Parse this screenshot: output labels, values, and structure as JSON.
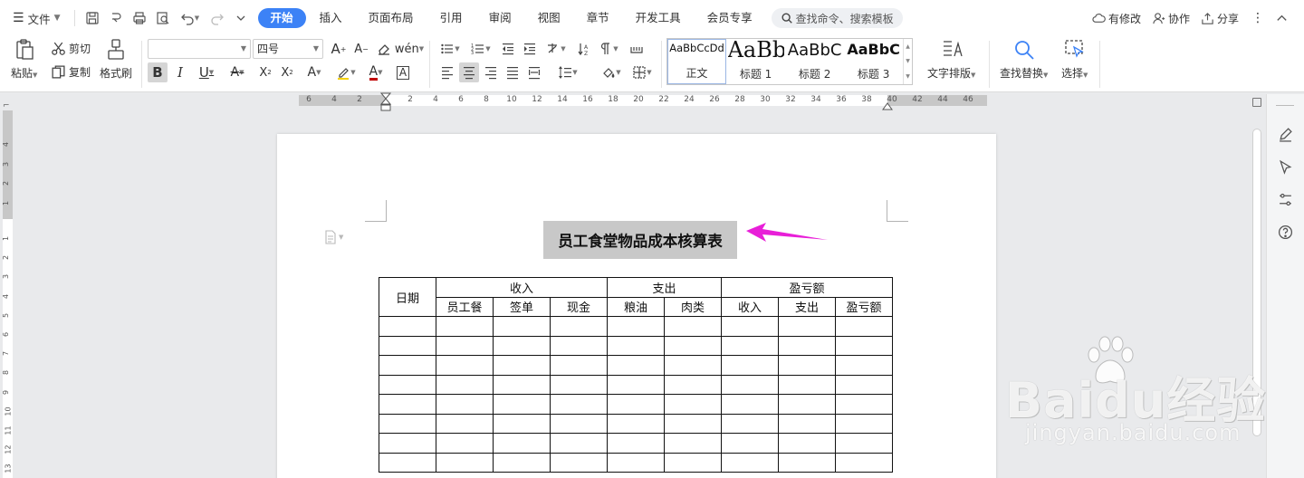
{
  "menubar": {
    "file_label": "文件",
    "tabs": [
      {
        "label": "开始",
        "active": true
      },
      {
        "label": "插入",
        "active": false
      },
      {
        "label": "页面布局",
        "active": false
      },
      {
        "label": "引用",
        "active": false
      },
      {
        "label": "审阅",
        "active": false
      },
      {
        "label": "视图",
        "active": false
      },
      {
        "label": "章节",
        "active": false
      },
      {
        "label": "开发工具",
        "active": false
      },
      {
        "label": "会员专享",
        "active": false
      }
    ],
    "search_placeholder": "查找命令、搜索模板",
    "right": {
      "modified": "有修改",
      "collab": "协作",
      "share": "分享"
    }
  },
  "ribbon": {
    "paste": "粘贴",
    "cut": "剪切",
    "copy": "复制",
    "format_painter": "格式刷",
    "font_name": "",
    "font_size": "四号",
    "styles": [
      {
        "preview": "AaBbCcDd",
        "name": "正文"
      },
      {
        "preview": "AaBb",
        "name": "标题 1"
      },
      {
        "preview": "AaBbC",
        "name": "标题 2"
      },
      {
        "preview": "AaBbC",
        "name": "标题 3"
      }
    ],
    "text_layout": "文字排版",
    "find_replace": "查找替换",
    "select": "选择"
  },
  "ruler": {
    "h_ticks": [
      "6",
      "4",
      "2",
      "2",
      "4",
      "6",
      "8",
      "10",
      "12",
      "14",
      "16",
      "18",
      "20",
      "22",
      "24",
      "26",
      "28",
      "30",
      "32",
      "34",
      "36",
      "38",
      "40",
      "42",
      "44",
      "46"
    ],
    "v_ticks": [
      "4",
      "3",
      "2",
      "1",
      "1",
      "2",
      "3",
      "4",
      "5",
      "6",
      "7",
      "8",
      "9",
      "10",
      "11",
      "12",
      "13"
    ]
  },
  "document": {
    "title": "员工食堂物品成本核算表",
    "table": {
      "date_header": "日期",
      "groups": [
        "收入",
        "支出",
        "盈亏额"
      ],
      "subheaders": [
        "员工餐",
        "签单",
        "现金",
        "粮油",
        "肉类",
        "收入",
        "支出",
        "盈亏额"
      ],
      "empty_rows": 8
    }
  },
  "watermark": {
    "brand": "Baidu经验",
    "site": "jingyan.baidu.com"
  },
  "colors": {
    "accent": "#3c82f6",
    "arrow": "#e81fd8",
    "title_highlight": "#c8c8c8"
  },
  "icons": {
    "quick_access": [
      "save-icon",
      "undo-history-icon",
      "print-icon",
      "print-preview-icon",
      "undo-icon",
      "redo-icon",
      "customize-icon"
    ],
    "side_panel": [
      "edit-icon",
      "pointer-icon",
      "settings-sliders-icon",
      "help-icon"
    ]
  }
}
